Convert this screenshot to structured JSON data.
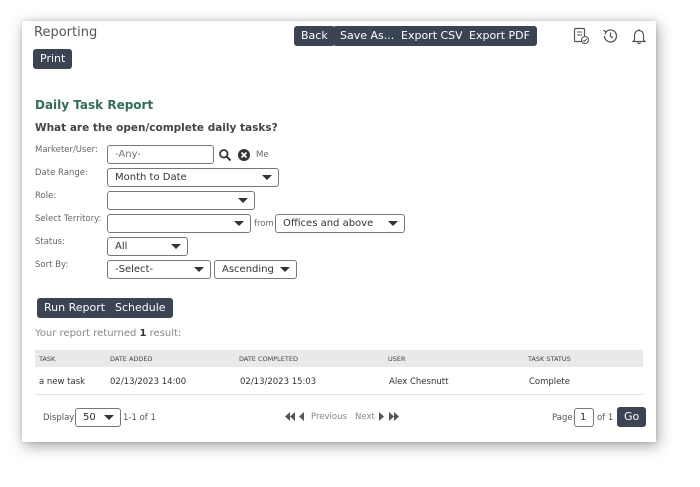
{
  "header": {
    "title": "Reporting",
    "buttons": {
      "back": "Back",
      "save_as": "Save As...",
      "export_csv": "Export CSV",
      "export_pdf": "Export PDF",
      "print": "Print"
    },
    "icons": [
      "report-check-icon",
      "history-icon",
      "bell-icon"
    ]
  },
  "report": {
    "title": "Daily Task Report",
    "question": "What are the open/complete daily tasks?"
  },
  "filters": {
    "marketer_label": "Marketer/User:",
    "marketer_value": "-Any-",
    "me_label": "Me",
    "date_range_label": "Date Range:",
    "date_range_value": "Month to Date",
    "role_label": "Role:",
    "role_value": "",
    "territory_label": "Select Territory:",
    "territory_value": "",
    "from_label": "from",
    "from_value": "Offices and above",
    "status_label": "Status:",
    "status_value": "All",
    "sort_label": "Sort By:",
    "sort_value": "-Select-",
    "sort_order_value": "Ascending"
  },
  "actions": {
    "run_report": "Run Report",
    "schedule": "Schedule"
  },
  "results": {
    "prefix": "Your report returned ",
    "count": "1",
    "suffix": " result:"
  },
  "table": {
    "columns": [
      "TASK",
      "DATE ADDED",
      "DATE COMPLETED",
      "USER",
      "TASK STATUS"
    ],
    "rows": [
      [
        "a new task",
        "02/13/2023 14:00",
        "02/13/2023 15:03",
        "Alex Chesnutt",
        "Complete"
      ]
    ]
  },
  "pagination": {
    "display_label": "Display",
    "display_value": "50",
    "range_text": "1-1 of 1",
    "previous": "Previous",
    "next": "Next",
    "page_label": "Page",
    "page_value": "1",
    "of_text": "of 1",
    "go": "Go"
  }
}
